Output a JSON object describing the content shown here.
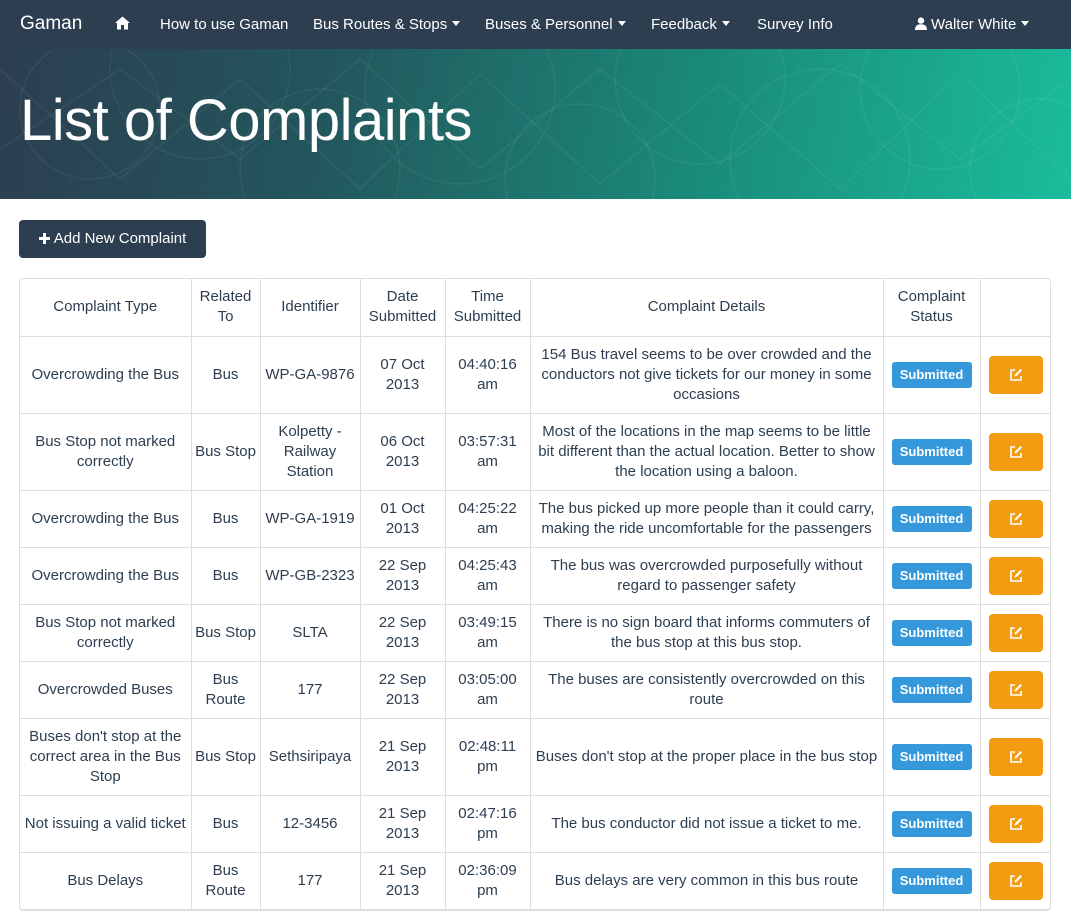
{
  "nav": {
    "brand": "Gaman",
    "home_icon": "home-icon",
    "how_to": "How to use Gaman",
    "bus_routes": "Bus Routes & Stops",
    "buses_personnel": "Buses & Personnel",
    "feedback": "Feedback",
    "survey": "Survey Info",
    "user_icon": "user-icon",
    "user": "Walter White"
  },
  "banner": {
    "title": "List of Complaints"
  },
  "actions": {
    "add_icon": "plus-icon",
    "add_label": "Add New Complaint"
  },
  "table": {
    "headers": [
      "Complaint Type",
      "Related To",
      "Identifier",
      "Date Submitted",
      "Time Submitted",
      "Complaint Details",
      "Complaint Status",
      ""
    ],
    "edit_icon": "edit-icon",
    "rows": [
      {
        "type": "Overcrowding the Bus",
        "related": "Bus",
        "identifier": "WP-GA-9876",
        "date": "07 Oct 2013",
        "time": "04:40:16 am",
        "details": "154 Bus travel seems to be over crowded and the conductors not give tickets for our money in some occasions",
        "status": "Submitted"
      },
      {
        "type": "Bus Stop not marked correctly",
        "related": "Bus Stop",
        "identifier": "Kolpetty - Railway Station",
        "date": "06 Oct 2013",
        "time": "03:57:31 am",
        "details": "Most of the locations in the map seems to be little bit different than the actual location. Better to show the location using a baloon.",
        "status": "Submitted"
      },
      {
        "type": "Overcrowding the Bus",
        "related": "Bus",
        "identifier": "WP-GA-1919",
        "date": "01 Oct 2013",
        "time": "04:25:22 am",
        "details": "The bus picked up more people than it could carry, making the ride uncomfortable for the passengers",
        "status": "Submitted"
      },
      {
        "type": "Overcrowding the Bus",
        "related": "Bus",
        "identifier": "WP-GB-2323",
        "date": "22 Sep 2013",
        "time": "04:25:43 am",
        "details": "The bus was overcrowded purposefully without regard to passenger safety",
        "status": "Submitted"
      },
      {
        "type": "Bus Stop not marked correctly",
        "related": "Bus Stop",
        "identifier": "SLTA",
        "date": "22 Sep 2013",
        "time": "03:49:15 am",
        "details": "There is no sign board that informs commuters of the bus stop at this bus stop.",
        "status": "Submitted"
      },
      {
        "type": "Overcrowded Buses",
        "related": "Bus Route",
        "identifier": "177",
        "date": "22 Sep 2013",
        "time": "03:05:00 am",
        "details": "The buses are consistently overcrowded on this route",
        "status": "Submitted"
      },
      {
        "type": "Buses don't stop at the correct area in the Bus Stop",
        "related": "Bus Stop",
        "identifier": "Sethsiripaya",
        "date": "21 Sep 2013",
        "time": "02:48:11 pm",
        "details": "Buses don't stop at the proper place in the bus stop",
        "status": "Submitted"
      },
      {
        "type": "Not issuing a valid ticket",
        "related": "Bus",
        "identifier": "12-3456",
        "date": "21 Sep 2013",
        "time": "02:47:16 pm",
        "details": "The bus conductor did not issue a ticket to me.",
        "status": "Submitted"
      },
      {
        "type": "Bus Delays",
        "related": "Bus Route",
        "identifier": "177",
        "date": "21 Sep 2013",
        "time": "02:36:09 pm",
        "details": "Bus delays are very common in this bus route",
        "status": "Submitted"
      }
    ]
  }
}
